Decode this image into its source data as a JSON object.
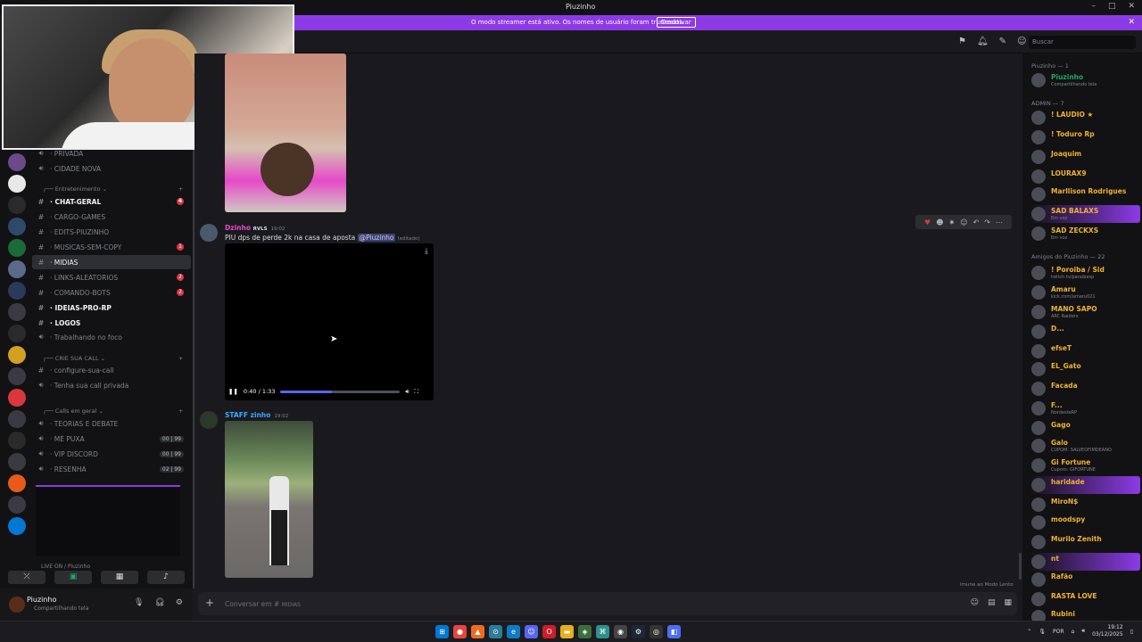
{
  "window": {
    "title": "Piuzinho"
  },
  "streamer_bar": {
    "message": "O modo streamer está ativo. Os nomes de usuário foram truncados.",
    "button": "Desativar"
  },
  "topbar": {
    "search_placeholder": "Buscar"
  },
  "channels": {
    "top_items": [
      "PRIVADA",
      "CIDADE NOVA"
    ],
    "cat_entretenimento": "Entretenimento",
    "entretenimento": [
      {
        "name": "CHAT-GERAL",
        "icon": "#",
        "bold": true,
        "count": "4"
      },
      {
        "name": "CARGO-GAMES",
        "icon": "#",
        "bold": false
      },
      {
        "name": "EDITS-PIUZINHO",
        "icon": "#",
        "bold": false
      },
      {
        "name": "MUSICAS-SEM-COPY",
        "icon": "#",
        "bold": false,
        "count": "1"
      },
      {
        "name": "MIDIAS",
        "icon": "#",
        "bold": false,
        "active": true
      },
      {
        "name": "LINKS-ALEATORIOS",
        "icon": "#",
        "bold": false,
        "count": "2"
      },
      {
        "name": "COMANDO-BOTS",
        "icon": "#",
        "bold": false,
        "count": "2"
      },
      {
        "name": "IDEIAS-PRO-RP",
        "icon": "#",
        "bold": true
      },
      {
        "name": "LOGOS",
        "icon": "#",
        "bold": true
      }
    ],
    "trabalhando": "Trabalhando no foco",
    "cat_crie": "CRIE SUA CALL",
    "crie": [
      "configure-sua-call",
      "Tenha sua call privada"
    ],
    "cat_calls": "Calls em geral",
    "calls": [
      {
        "name": "TEORIAS E DEBATE"
      },
      {
        "name": "ME PUXA",
        "pill": "00 | 99"
      },
      {
        "name": "VIP DISCORD",
        "pill": "00 | 99"
      },
      {
        "name": "RESENHA",
        "pill": "02 | 99"
      }
    ],
    "live_label": "LIVE ON / Piuzinho"
  },
  "user_panel": {
    "name": "Piuzinho",
    "status": "Compartilhando tela"
  },
  "messages": [
    {
      "user": "Dzinho",
      "tag": "RVLS",
      "time": "19:02",
      "color": "#e64ac8",
      "text": "PIU dps de perde 2k na casa de aposta",
      "mention": "@Piuzinho",
      "edited": "(editado)"
    },
    {
      "user": "STAFF zinho",
      "time": "19:02",
      "color": "#3ba8ff"
    }
  ],
  "video": {
    "time": "0:40 / 1:33",
    "progress": 0.43
  },
  "slowmode": "Imune ao Modo Lento",
  "composer": {
    "placeholder": "Conversar em #",
    "channel": "MIDIAS"
  },
  "members": {
    "groups": [
      {
        "label": "Piuzinho — 1"
      },
      {
        "label": "ADMIN — 7"
      },
      {
        "label": "Amigos do Piuzinho — 22"
      }
    ],
    "list": [
      {
        "name": "Piuzinho",
        "sub": "Compartilhando tela",
        "color": "#23a55a"
      },
      {
        "name": "! LAUDIO ★",
        "sub": "",
        "color": "#f0b232"
      },
      {
        "name": "! Toduro Rp",
        "sub": "",
        "color": "#f0b232"
      },
      {
        "name": "Joaquim",
        "sub": "",
        "color": "#f0b232"
      },
      {
        "name": "LOURAX9",
        "sub": "",
        "color": "#f0b232"
      },
      {
        "name": "Marllison Rodrigues",
        "sub": "",
        "color": "#f0b232"
      },
      {
        "name": "SAD BALAXS",
        "sub": "Em voz",
        "color": "#f0b232",
        "hl": true
      },
      {
        "name": "SAD ZECKXS",
        "sub": "Em voz",
        "color": "#f0b232"
      },
      {
        "name": "! Poroiba / Sid",
        "sub": "twitch.tv/paraibasp",
        "color": "#f0b232"
      },
      {
        "name": "Amaru",
        "sub": "kick.com/amaru021",
        "color": "#f0b232"
      },
      {
        "name": "MANO SAPO",
        "sub": "ARC Raiders",
        "color": "#f0b232"
      },
      {
        "name": "D...",
        "sub": "",
        "color": "#f0b232"
      },
      {
        "name": "efseT",
        "sub": "",
        "color": "#f0b232"
      },
      {
        "name": "EL_Gato",
        "sub": "",
        "color": "#f0b232"
      },
      {
        "name": "Facada",
        "sub": "",
        "color": "#f0b232"
      },
      {
        "name": "F...",
        "sub": "NordesteRP",
        "color": "#f0b232"
      },
      {
        "name": "Gago",
        "sub": "",
        "color": "#f0b232"
      },
      {
        "name": "Galo",
        "sub": "CUPOM: SALVEOFIMDEANO",
        "color": "#f0b232"
      },
      {
        "name": "Gi Fortune",
        "sub": "Cupom: GIFORTUNE",
        "color": "#f0b232"
      },
      {
        "name": "haridade",
        "sub": "",
        "color": "#f0b232",
        "hl": true
      },
      {
        "name": "MiroN$",
        "sub": "",
        "color": "#f0b232"
      },
      {
        "name": "moodspy",
        "sub": "",
        "color": "#f0b232"
      },
      {
        "name": "Murilo Zenith",
        "sub": "",
        "color": "#f0b232"
      },
      {
        "name": "nt",
        "sub": "",
        "color": "#f0b232",
        "hl": true
      },
      {
        "name": "Rafão",
        "sub": "",
        "color": "#f0b232"
      },
      {
        "name": "RASTA LOVE",
        "sub": "",
        "color": "#f0b232"
      },
      {
        "name": "Rubini",
        "sub": "",
        "color": "#f0b232"
      }
    ]
  },
  "taskbar": {
    "lang": "POR",
    "time": "19:12",
    "date": "03/12/2025"
  }
}
